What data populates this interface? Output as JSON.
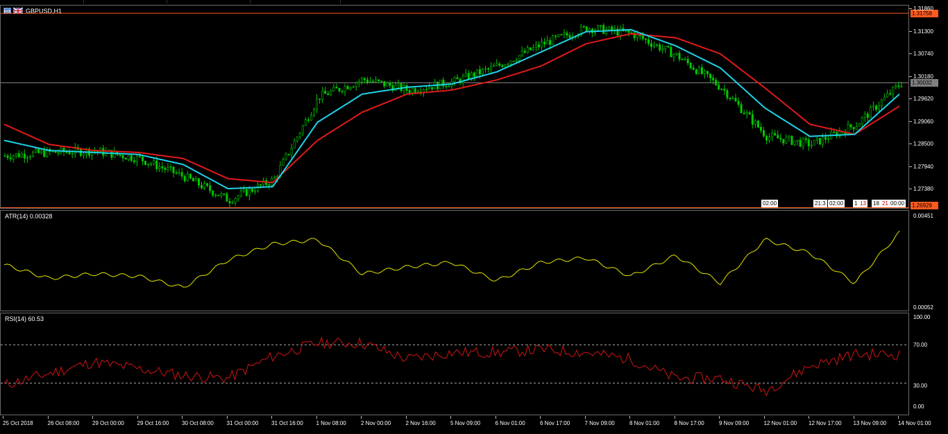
{
  "window": {
    "symbol_title": "GBPUSD,H1"
  },
  "main": {
    "y_ticks": [
      "1.31860",
      "1.31300",
      "1.30740",
      "1.30180",
      "1.29620",
      "1.29060",
      "1.28500",
      "1.27940",
      "1.27380"
    ],
    "y_min": 1.2692,
    "y_max": 1.3195,
    "level_high": "1.31758",
    "level_low": "1.26929",
    "bid": "1.30032",
    "time_tags": [
      "02:00",
      "21:3",
      "02:00",
      "1",
      "13",
      "18",
      "21",
      "00:00"
    ]
  },
  "atr": {
    "title": "ATR(14) 0.00328",
    "y_ticks": [
      "0.00451",
      "0.00052"
    ]
  },
  "rsi": {
    "title": "RSI(14) 60.53",
    "y_ticks": [
      "100.00",
      "70.00",
      "30.00",
      "0.00"
    ]
  },
  "x_axis": {
    "labels": [
      "25 Oct 2018",
      "26 Oct 08:00",
      "29 Oct 00:00",
      "29 Oct 16:00",
      "30 Oct 08:00",
      "31 Oct 00:00",
      "31 Oct 16:00",
      "1 Nov 08:00",
      "2 Nov 00:00",
      "2 Nov 16:00",
      "5 Nov 09:00",
      "6 Nov 01:00",
      "6 Nov 17:00",
      "7 Nov 09:00",
      "8 Nov 01:00",
      "8 Nov 17:00",
      "9 Nov 09:00",
      "12 Nov 01:00",
      "12 Nov 17:00",
      "13 Nov 09:00",
      "14 Nov 01:00"
    ]
  },
  "colors": {
    "candle": "#00c800",
    "ma_fast": "#1fd3e8",
    "ma_slow": "#e21a1a",
    "atr_line": "#e6e600",
    "rsi_line": "#d01515",
    "level_line": "#ff5a1f",
    "bid_line": "#8a8a8a"
  },
  "chart_data": [
    {
      "type": "line",
      "title": "GBPUSD,H1",
      "series": [],
      "x": [
        "25 Oct 2018",
        "26 Oct 08:00",
        "29 Oct 00:00",
        "29 Oct 16:00",
        "30 Oct 08:00",
        "31 Oct 00:00",
        "31 Oct 16:00",
        "1 Nov 08:00",
        "2 Nov 00:00",
        "2 Nov 16:00",
        "5 Nov 09:00",
        "6 Nov 01:00",
        "6 Nov 17:00",
        "7 Nov 09:00",
        "8 Nov 01:00",
        "8 Nov 17:00",
        "9 Nov 09:00",
        "12 Nov 01:00",
        "12 Nov 17:00",
        "13 Nov 09:00",
        "14 Nov 01:00"
      ],
      "close_estimates": [
        1.2822,
        1.283,
        1.2834,
        1.2815,
        1.277,
        1.2712,
        1.2762,
        1.2968,
        1.3012,
        1.2985,
        1.3005,
        1.3045,
        1.31,
        1.314,
        1.3125,
        1.307,
        1.299,
        1.287,
        1.285,
        1.29,
        1.3003
      ],
      "ma_fast_estimates": [
        1.286,
        1.2835,
        1.283,
        1.2825,
        1.28,
        1.274,
        1.2745,
        1.2905,
        1.2975,
        1.2992,
        1.3,
        1.303,
        1.308,
        1.313,
        1.3135,
        1.3095,
        1.304,
        1.294,
        1.287,
        1.2875,
        1.2975
      ],
      "ma_slow_estimates": [
        1.29,
        1.285,
        1.2835,
        1.283,
        1.2815,
        1.2765,
        1.2755,
        1.286,
        1.293,
        1.2975,
        1.2985,
        1.301,
        1.3045,
        1.31,
        1.3125,
        1.3115,
        1.3075,
        1.299,
        1.29,
        1.2875,
        1.2945
      ],
      "ylim": [
        1.2692,
        1.3195
      ]
    },
    {
      "type": "line",
      "title": "ATR(14) 0.00328",
      "x": [
        "25 Oct 2018",
        "26 Oct 08:00",
        "29 Oct 00:00",
        "29 Oct 16:00",
        "30 Oct 08:00",
        "31 Oct 00:00",
        "31 Oct 16:00",
        "1 Nov 08:00",
        "2 Nov 00:00",
        "2 Nov 16:00",
        "5 Nov 09:00",
        "6 Nov 01:00",
        "6 Nov 17:00",
        "7 Nov 09:00",
        "8 Nov 01:00",
        "8 Nov 17:00",
        "9 Nov 09:00",
        "12 Nov 01:00",
        "12 Nov 17:00",
        "13 Nov 09:00",
        "14 Nov 01:00"
      ],
      "values": [
        0.0024,
        0.0018,
        0.002,
        0.0019,
        0.0014,
        0.0026,
        0.0033,
        0.0035,
        0.002,
        0.0023,
        0.0025,
        0.0017,
        0.0025,
        0.0027,
        0.0019,
        0.0028,
        0.0016,
        0.0035,
        0.0029,
        0.0016,
        0.0038
      ],
      "ylim": [
        0.00052,
        0.00451
      ]
    },
    {
      "type": "line",
      "title": "RSI(14) 60.53",
      "x": [
        "25 Oct 2018",
        "26 Oct 08:00",
        "29 Oct 00:00",
        "29 Oct 16:00",
        "30 Oct 08:00",
        "31 Oct 00:00",
        "31 Oct 16:00",
        "1 Nov 08:00",
        "2 Nov 00:00",
        "2 Nov 16:00",
        "5 Nov 09:00",
        "6 Nov 01:00",
        "6 Nov 17:00",
        "7 Nov 09:00",
        "8 Nov 01:00",
        "8 Nov 17:00",
        "9 Nov 09:00",
        "12 Nov 01:00",
        "12 Nov 17:00",
        "13 Nov 09:00",
        "14 Nov 01:00"
      ],
      "values": [
        28,
        40,
        52,
        45,
        38,
        35,
        58,
        72,
        72,
        55,
        62,
        62,
        65,
        62,
        55,
        35,
        35,
        22,
        48,
        60,
        60
      ],
      "levels": [
        70,
        30
      ],
      "ylim": [
        0,
        100
      ]
    }
  ]
}
